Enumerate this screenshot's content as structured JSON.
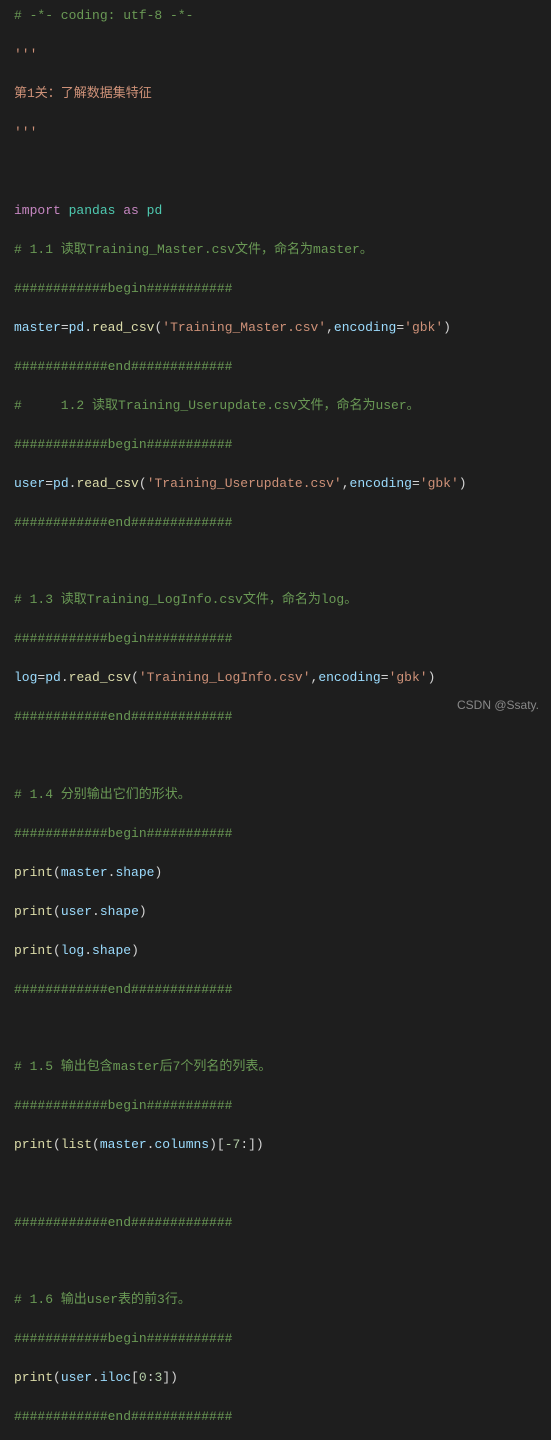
{
  "lines": {
    "l1": "# -*- coding: utf-8 -*-",
    "l2": "'''",
    "l3": "第1关：了解数据集特征",
    "l4": "'''",
    "l5a": "import",
    "l5b": " pandas ",
    "l5c": "as",
    "l5d": " pd",
    "l6": "# 1.1 读取Training_Master.csv文件，命名为master。",
    "l7": "############begin###########",
    "l8a": "master",
    "l8b": "=",
    "l8c": "pd",
    "l8d": ".",
    "l8e": "read_csv",
    "l8f": "(",
    "l8g": "'Training_Master.csv'",
    "l8h": ",",
    "l8i": "encoding",
    "l8j": "=",
    "l8k": "'gbk'",
    "l8l": ")",
    "l9": "############end#############",
    "l10": "#     1.2 读取Training_Userupdate.csv文件，命名为user。",
    "l11": "############begin###########",
    "l12a": "user",
    "l12b": "=",
    "l12c": "pd",
    "l12d": ".",
    "l12e": "read_csv",
    "l12f": "(",
    "l12g": "'Training_Userupdate.csv'",
    "l12h": ",",
    "l12i": "encoding",
    "l12j": "=",
    "l12k": "'gbk'",
    "l12l": ")",
    "l13": "############end#############",
    "l14": "# 1.3 读取Training_LogInfo.csv文件，命名为log。",
    "l15": "############begin###########",
    "l16a": "log",
    "l16b": "=",
    "l16c": "pd",
    "l16d": ".",
    "l16e": "read_csv",
    "l16f": "(",
    "l16g": "'Training_LogInfo.csv'",
    "l16h": ",",
    "l16i": "encoding",
    "l16j": "=",
    "l16k": "'gbk'",
    "l16l": ")",
    "l17": "############end#############",
    "l18": "# 1.4 分别输出它们的形状。",
    "l19": "############begin###########",
    "l20a": "print",
    "l20b": "(",
    "l20c": "master",
    "l20d": ".",
    "l20e": "shape",
    "l20f": ")",
    "l21a": "print",
    "l21b": "(",
    "l21c": "user",
    "l21d": ".",
    "l21e": "shape",
    "l21f": ")",
    "l22a": "print",
    "l22b": "(",
    "l22c": "log",
    "l22d": ".",
    "l22e": "shape",
    "l22f": ")",
    "l23": "############end#############",
    "l24": "# 1.5 输出包含master后7个列名的列表。",
    "l25": "############begin###########",
    "l26a": "print",
    "l26b": "(",
    "l26c": "list",
    "l26d": "(",
    "l26e": "master",
    "l26f": ".",
    "l26g": "columns",
    "l26h": ")[",
    "l26i": "-7",
    "l26j": ":])",
    "l27": "############end#############",
    "l28": "# 1.6 输出user表的前3行。",
    "l29": "############begin###########",
    "l30a": "print",
    "l30b": "(",
    "l30c": "user",
    "l30d": ".",
    "l30e": "iloc",
    "l30f": "[",
    "l30g": "0",
    "l30h": ":",
    "l30i": "3",
    "l30j": "])",
    "l31": "############end#############"
  },
  "watermark": "CSDN @Ssaty."
}
